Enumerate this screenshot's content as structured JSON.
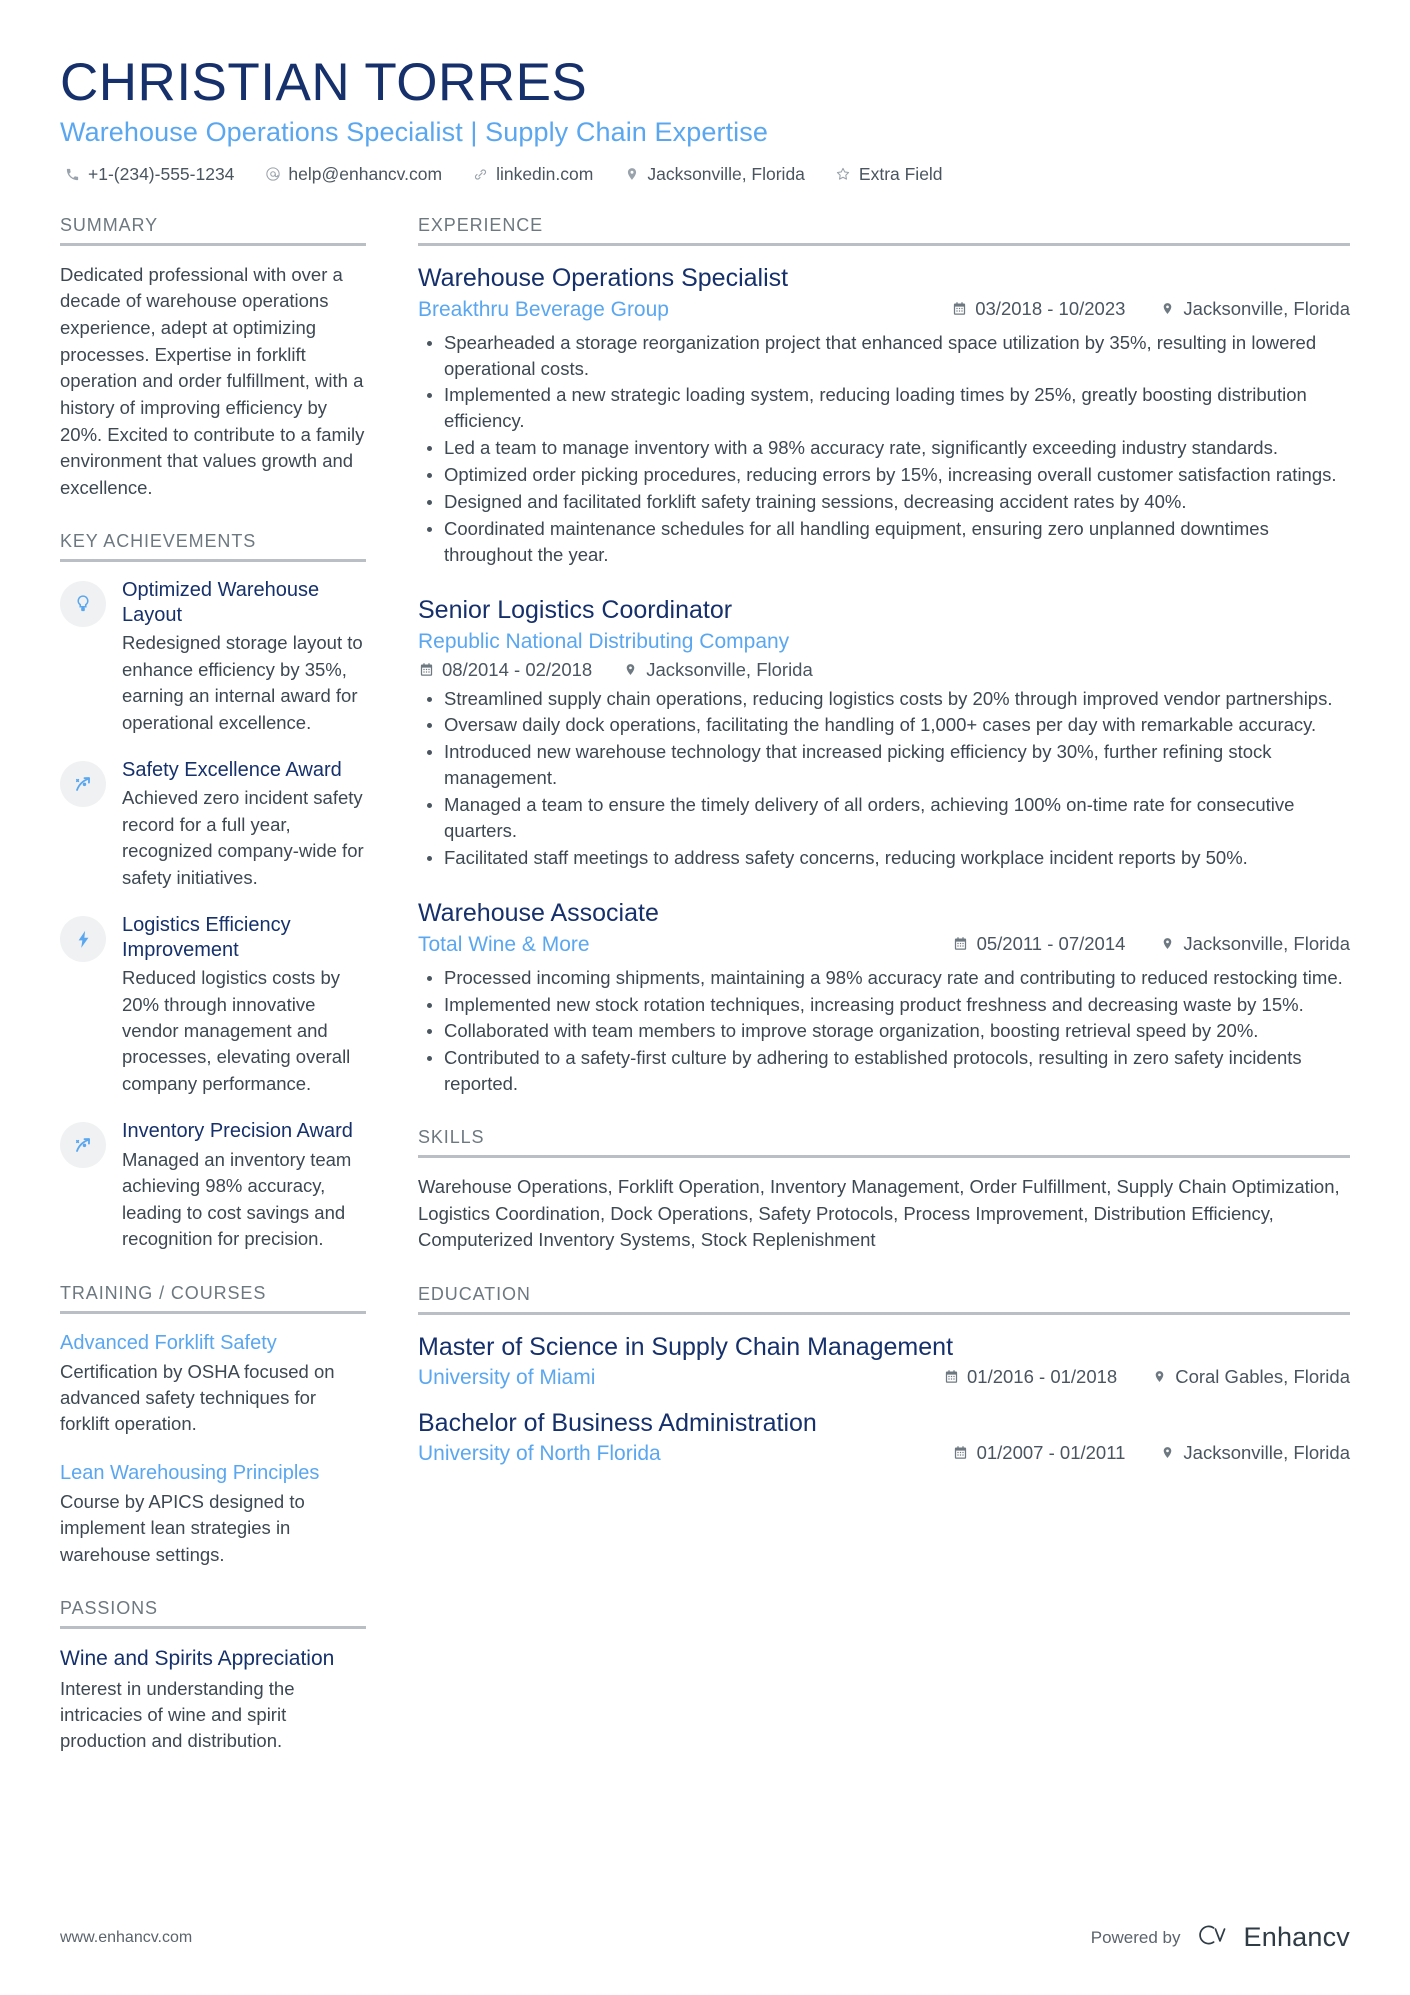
{
  "header": {
    "name": "CHRISTIAN TORRES",
    "headline": "Warehouse Operations Specialist | Supply Chain Expertise",
    "contacts": [
      {
        "icon": "phone-icon",
        "text": "+1-(234)-555-1234"
      },
      {
        "icon": "email-icon",
        "text": "help@enhancv.com"
      },
      {
        "icon": "link-icon",
        "text": "linkedin.com"
      },
      {
        "icon": "location-icon",
        "text": "Jacksonville, Florida"
      },
      {
        "icon": "star-icon",
        "text": "Extra Field"
      }
    ]
  },
  "summary": {
    "title": "SUMMARY",
    "text": "Dedicated professional with over a decade of warehouse operations experience, adept at optimizing processes. Expertise in forklift operation and order fulfillment, with a history of improving efficiency by 20%. Excited to contribute to a family environment that values growth and excellence."
  },
  "key_achievements": {
    "title": "KEY ACHIEVEMENTS",
    "items": [
      {
        "icon": "lightbulb-icon",
        "title": "Optimized Warehouse Layout",
        "description": "Redesigned storage layout to enhance efficiency by 35%, earning an internal award for operational excellence."
      },
      {
        "icon": "trend-arrow-icon",
        "title": "Safety Excellence Award",
        "description": "Achieved zero incident safety record for a full year, recognized company-wide for safety initiatives."
      },
      {
        "icon": "lightning-bolt-icon",
        "title": "Logistics Efficiency Improvement",
        "description": "Reduced logistics costs by 20% through innovative vendor management and processes, elevating overall company performance."
      },
      {
        "icon": "trend-arrow-icon",
        "title": "Inventory Precision Award",
        "description": "Managed an inventory team achieving 98% accuracy, leading to cost savings and recognition for precision."
      }
    ]
  },
  "training": {
    "title": "TRAINING / COURSES",
    "items": [
      {
        "title": "Advanced Forklift Safety",
        "description": "Certification by OSHA focused on advanced safety techniques for forklift operation."
      },
      {
        "title": "Lean Warehousing Principles",
        "description": "Course by APICS designed to implement lean strategies in warehouse settings."
      }
    ]
  },
  "passions": {
    "title": "PASSIONS",
    "items": [
      {
        "title": "Wine and Spirits Appreciation",
        "description": "Interest in understanding the intricacies of wine and spirit production and distribution."
      }
    ]
  },
  "experience": {
    "title": "EXPERIENCE",
    "jobs": [
      {
        "title": "Warehouse Operations Specialist",
        "company": "Breakthru Beverage Group",
        "dates": "03/2018 - 10/2023",
        "location": "Jacksonville, Florida",
        "layout": "inline",
        "bullets": [
          "Spearheaded a storage reorganization project that enhanced space utilization by 35%, resulting in lowered operational costs.",
          "Implemented a new strategic loading system, reducing loading times by 25%, greatly boosting distribution efficiency.",
          "Led a team to manage inventory with a 98% accuracy rate, significantly exceeding industry standards.",
          "Optimized order picking procedures, reducing errors by 15%, increasing overall customer satisfaction ratings.",
          "Designed and facilitated forklift safety training sessions, decreasing accident rates by 40%.",
          "Coordinated maintenance schedules for all handling equipment, ensuring zero unplanned downtimes throughout the year."
        ]
      },
      {
        "title": "Senior Logistics Coordinator",
        "company": "Republic National Distributing Company",
        "dates": "08/2014 - 02/2018",
        "location": "Jacksonville, Florida",
        "layout": "stacked",
        "bullets": [
          "Streamlined supply chain operations, reducing logistics costs by 20% through improved vendor partnerships.",
          "Oversaw daily dock operations, facilitating the handling of 1,000+ cases per day with remarkable accuracy.",
          "Introduced new warehouse technology that increased picking efficiency by 30%, further refining stock management.",
          "Managed a team to ensure the timely delivery of all orders, achieving 100% on-time rate for consecutive quarters.",
          "Facilitated staff meetings to address safety concerns, reducing workplace incident reports by 50%."
        ]
      },
      {
        "title": "Warehouse Associate",
        "company": "Total Wine & More",
        "dates": "05/2011 - 07/2014",
        "location": "Jacksonville, Florida",
        "layout": "inline",
        "bullets": [
          "Processed incoming shipments, maintaining a 98% accuracy rate and contributing to reduced restocking time.",
          "Implemented new stock rotation techniques, increasing product freshness and decreasing waste by 15%.",
          "Collaborated with team members to improve storage organization, boosting retrieval speed by 20%.",
          "Contributed to a safety-first culture by adhering to established protocols, resulting in zero safety incidents reported."
        ]
      }
    ]
  },
  "skills": {
    "title": "SKILLS",
    "text": "Warehouse Operations, Forklift Operation, Inventory Management, Order Fulfillment, Supply Chain Optimization, Logistics Coordination, Dock Operations, Safety Protocols, Process Improvement, Distribution Efficiency, Computerized Inventory Systems, Stock Replenishment"
  },
  "education": {
    "title": "EDUCATION",
    "items": [
      {
        "degree": "Master of Science in Supply Chain Management",
        "school": "University of Miami",
        "dates": "01/2016 - 01/2018",
        "location": "Coral Gables, Florida"
      },
      {
        "degree": "Bachelor of Business Administration",
        "school": "University of North Florida",
        "dates": "01/2007 - 01/2011",
        "location": "Jacksonville, Florida"
      }
    ]
  },
  "footer": {
    "site": "www.enhancv.com",
    "powered_by": "Powered by",
    "brand": "Enhancv"
  },
  "colors": {
    "navy": "#16306b",
    "accent_blue": "#5aa7f0",
    "body_gray": "#3d4852",
    "muted_gray": "#6d7880",
    "rule_gray": "#b9bfc5"
  }
}
